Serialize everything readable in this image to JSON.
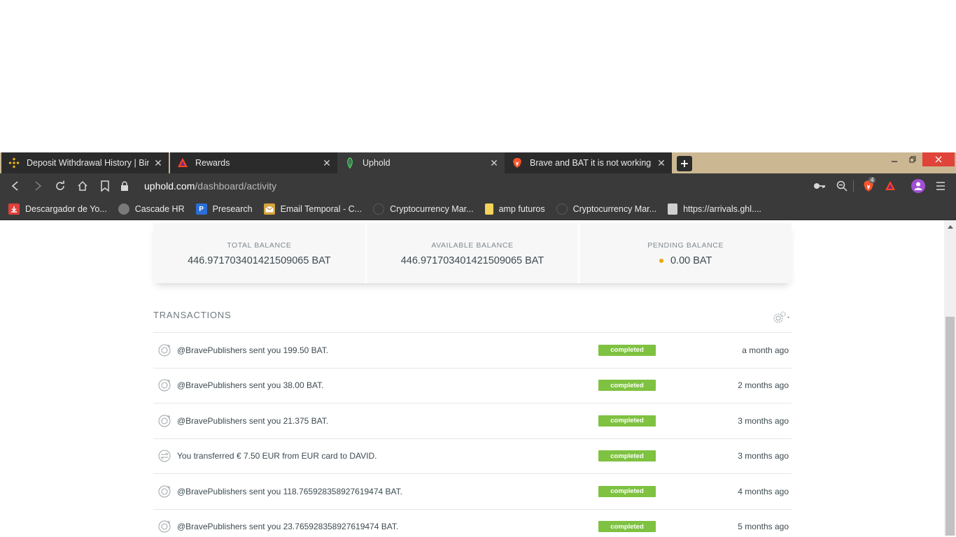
{
  "browser": {
    "tabs": [
      {
        "title": "Deposit Withdrawal History | Binar",
        "icon": "binance-icon"
      },
      {
        "title": "Rewards",
        "icon": "bat-triangle-icon"
      },
      {
        "title": "Uphold",
        "icon": "uphold-icon"
      },
      {
        "title": "Brave and BAT it is not working pro",
        "icon": "brave-lion-icon"
      }
    ],
    "address": {
      "host": "uphold.com",
      "path": "/dashboard/activity"
    },
    "brave_shield_count": "4",
    "bookmarks": [
      {
        "label": "Descargador de Yo...",
        "icon": "download-icon",
        "color": "#e0403a"
      },
      {
        "label": "Cascade HR",
        "icon": "globe-icon",
        "color": "#7a7a7a"
      },
      {
        "label": "Presearch",
        "icon": "presearch-icon",
        "color": "#2c6ed8"
      },
      {
        "label": "Email Temporal - C...",
        "icon": "mail-icon",
        "color": "#d8a33a"
      },
      {
        "label": "Cryptocurrency Mar...",
        "icon": "coinmarketcap-icon",
        "color": "#5a5a5a"
      },
      {
        "label": "amp futuros",
        "icon": "folder-icon",
        "color": "#f3d35a"
      },
      {
        "label": "Cryptocurrency Mar...",
        "icon": "coinmarketcap-icon",
        "color": "#5a5a5a"
      },
      {
        "label": "https://arrivals.ghl....",
        "icon": "document-icon",
        "color": "#d0d0d0"
      }
    ]
  },
  "balances": [
    {
      "label": "TOTAL BALANCE",
      "value": "446.971703401421509065 BAT"
    },
    {
      "label": "AVAILABLE BALANCE",
      "value": "446.971703401421509065 BAT"
    },
    {
      "label": "PENDING BALANCE",
      "value": "0.00 BAT"
    }
  ],
  "transactions": {
    "title": "TRANSACTIONS",
    "rows": [
      {
        "description": "@BravePublishers sent you 199.50 BAT.",
        "status": "completed",
        "time": "a month ago",
        "type": "receive"
      },
      {
        "description": "@BravePublishers sent you 38.00 BAT.",
        "status": "completed",
        "time": "2 months ago",
        "type": "receive"
      },
      {
        "description": "@BravePublishers sent you 21.375 BAT.",
        "status": "completed",
        "time": "3 months ago",
        "type": "receive"
      },
      {
        "description": "You transferred € 7.50 EUR from EUR card to DAVID.",
        "status": "completed",
        "time": "3 months ago",
        "type": "transfer"
      },
      {
        "description": "@BravePublishers sent you 118.765928358927619474 BAT.",
        "status": "completed",
        "time": "4 months ago",
        "type": "receive"
      },
      {
        "description": "@BravePublishers sent you 23.765928358927619474 BAT.",
        "status": "completed",
        "time": "5 months ago",
        "type": "receive"
      }
    ]
  },
  "colors": {
    "status_completed": "#7fc241",
    "pending_dot": "#e8a800",
    "tab_strip": "#cbb892"
  }
}
